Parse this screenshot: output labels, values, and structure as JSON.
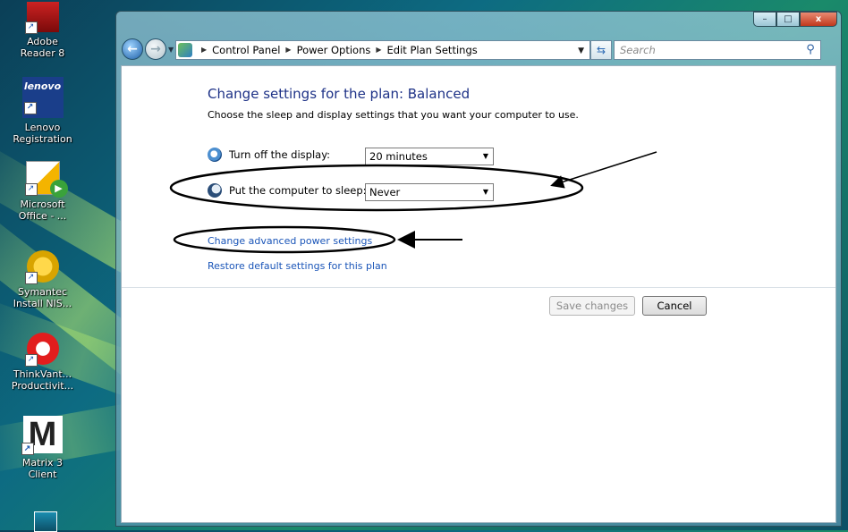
{
  "desktop": {
    "icons": [
      {
        "label1": "Adobe",
        "label2": "Reader 8",
        "icon": "adobe-reader-icon"
      },
      {
        "label1": "Lenovo",
        "label2": "Registration",
        "icon": "lenovo-icon",
        "badge": "lenovo"
      },
      {
        "label1": "Microsoft",
        "label2": "Office - ...",
        "icon": "office-icon"
      },
      {
        "label1": "Symantec",
        "label2": "Install NIS...",
        "icon": "symantec-icon"
      },
      {
        "label1": "ThinkVant...",
        "label2": "Productivit...",
        "icon": "thinkvantage-icon"
      },
      {
        "label1": "Matrix 3",
        "label2": "Client",
        "icon": "matrix-icon",
        "glyph": "M"
      }
    ]
  },
  "window": {
    "caption_buttons": {
      "minimize": "–",
      "maximize": "□",
      "close": "x"
    },
    "address": {
      "crumbs": [
        "Control Panel",
        "Power Options",
        "Edit Plan Settings"
      ]
    },
    "search": {
      "placeholder": "Search"
    }
  },
  "plan": {
    "title": "Change settings for the plan: Balanced",
    "description": "Choose the sleep and display settings that you want your computer to use.",
    "display": {
      "label": "Turn off the display:",
      "value": "20 minutes"
    },
    "sleep": {
      "label": "Put the computer to sleep:",
      "value": "Never"
    },
    "advanced_link": "Change advanced power settings",
    "restore_link": "Restore default settings for this plan"
  },
  "buttons": {
    "save": "Save changes",
    "cancel": "Cancel"
  }
}
